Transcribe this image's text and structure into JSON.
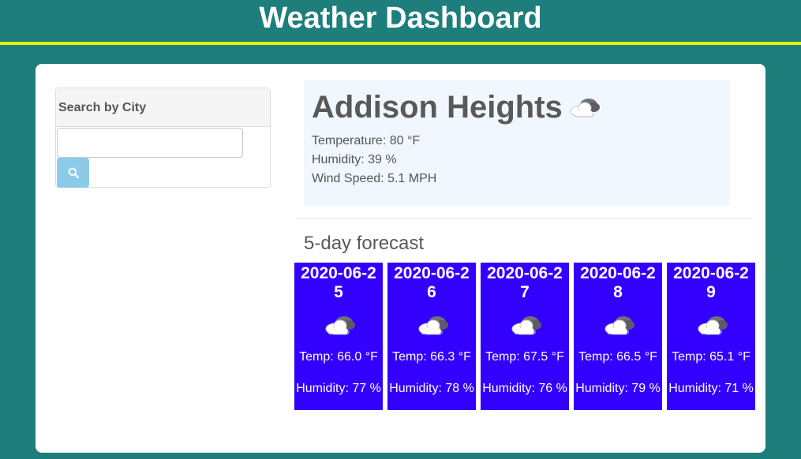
{
  "header": {
    "title": "Weather Dashboard"
  },
  "colors": {
    "page_bg": "#1e7e7c",
    "header_rule": "#e4f00a",
    "forecast_card_bg": "#3300ff",
    "search_button_bg": "#8ccbe8"
  },
  "search": {
    "heading": "Search by City",
    "input_value": "",
    "placeholder": "",
    "button_icon": "search-icon"
  },
  "current": {
    "city": "Addison Heights",
    "icon": "cloudy-icon",
    "temperature": "Temperature: 80 °F",
    "humidity": "Humidity: 39 %",
    "wind": "Wind Speed: 5.1 MPH"
  },
  "forecast": {
    "title": "5-day forecast",
    "days": [
      {
        "date": "2020-06-25",
        "icon": "cloudy-icon",
        "temp": "Temp: 66.0 °F",
        "humidity": "Humidity: 77 %"
      },
      {
        "date": "2020-06-26",
        "icon": "cloudy-icon",
        "temp": "Temp: 66.3 °F",
        "humidity": "Humidity: 78 %"
      },
      {
        "date": "2020-06-27",
        "icon": "cloudy-icon",
        "temp": "Temp: 67.5 °F",
        "humidity": "Humidity: 76 %"
      },
      {
        "date": "2020-06-28",
        "icon": "cloudy-icon",
        "temp": "Temp: 66.5 °F",
        "humidity": "Humidity: 79 %"
      },
      {
        "date": "2020-06-29",
        "icon": "cloudy-icon",
        "temp": "Temp: 65.1 °F",
        "humidity": "Humidity: 71 %"
      }
    ]
  }
}
